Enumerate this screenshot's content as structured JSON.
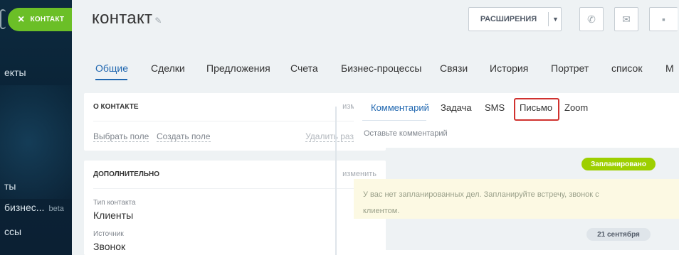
{
  "sidebar": {
    "items": [
      {
        "label": "екты"
      },
      {
        "label": "ты"
      },
      {
        "label": "бизнес...",
        "badge": "beta"
      },
      {
        "label": "ссы"
      }
    ]
  },
  "close_pill": {
    "label": "КОНТАКТ",
    "color": "#6bbf27"
  },
  "header": {
    "title": "контакт",
    "extensions_label": "РАСШИРЕНИЯ"
  },
  "tabs": [
    "Общие",
    "Сделки",
    "Предложения",
    "Счета",
    "Бизнес-процессы",
    "Связи",
    "История",
    "Портрет",
    "список",
    "М"
  ],
  "about_card": {
    "title": "О КОНТАКТЕ",
    "edit": "изменить",
    "select_field": "Выбрать поле",
    "create_field": "Создать поле",
    "delete_section": "Удалить раздел"
  },
  "extra_card": {
    "title": "ДОПОЛНИТЕЛЬНО",
    "edit": "изменить",
    "fields": [
      {
        "label": "Тип контакта",
        "value": "Клиенты"
      },
      {
        "label": "Источник",
        "value": "Звонок"
      }
    ]
  },
  "editor": {
    "tabs": [
      "Комментарий",
      "Задача",
      "SMS",
      "Письмо",
      "Zoom"
    ],
    "placeholder": "Оставьте комментарий"
  },
  "timeline": {
    "planned_label": "Запланировано",
    "note": "У вас нет запланированных дел. Запланируйте встречу, звонок с клиентом.",
    "date_label": "21 сентября"
  },
  "colors": {
    "accent": "#2067b0",
    "green": "#6bbf27",
    "info": "#8dc03f",
    "chat": "#2fc6f6",
    "highlight": "#d0322f"
  }
}
